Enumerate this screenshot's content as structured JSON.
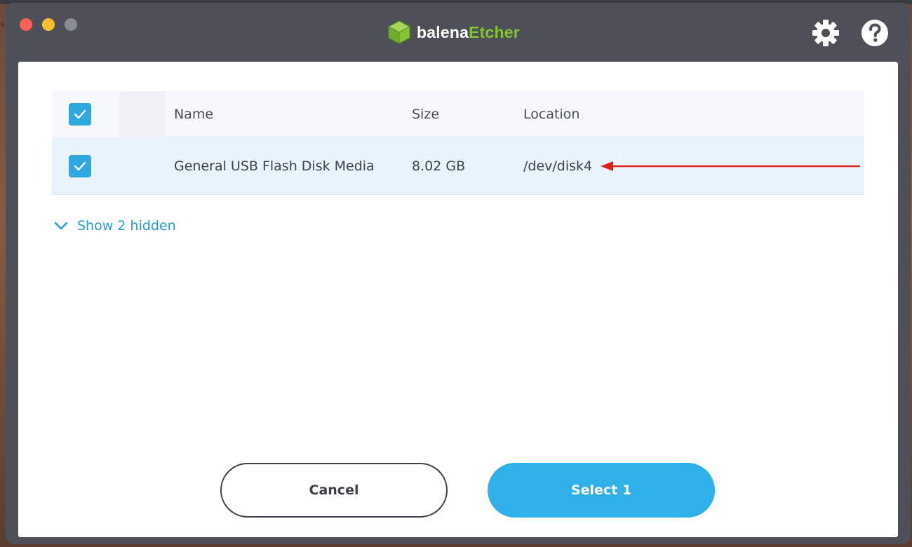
{
  "app": {
    "brand_prefix": "balena",
    "brand_suffix": "Etcher",
    "brand_colors": {
      "prefix": "#ffffff",
      "suffix": "#86c232"
    },
    "icons": {
      "settings": "gear-icon",
      "help": "help-icon"
    }
  },
  "desktop": {
    "edge_glyph": "x"
  },
  "table": {
    "headers": {
      "name": "Name",
      "size": "Size",
      "location": "Location"
    },
    "select_all_checked": true,
    "rows": [
      {
        "checked": true,
        "name": "General USB Flash Disk Media",
        "size": "8.02 GB",
        "location": "/dev/disk4"
      }
    ]
  },
  "show_hidden": {
    "label": "Show 2 hidden",
    "icon": "chevron-down-icon"
  },
  "buttons": {
    "cancel": "Cancel",
    "select": "Select 1"
  },
  "colors": {
    "accent": "#2fb0e8",
    "checkbox": "#2fa8df",
    "link": "#2a9ccd",
    "annotation_arrow": "#e0211c",
    "selected_row": "#e8f3fc"
  }
}
